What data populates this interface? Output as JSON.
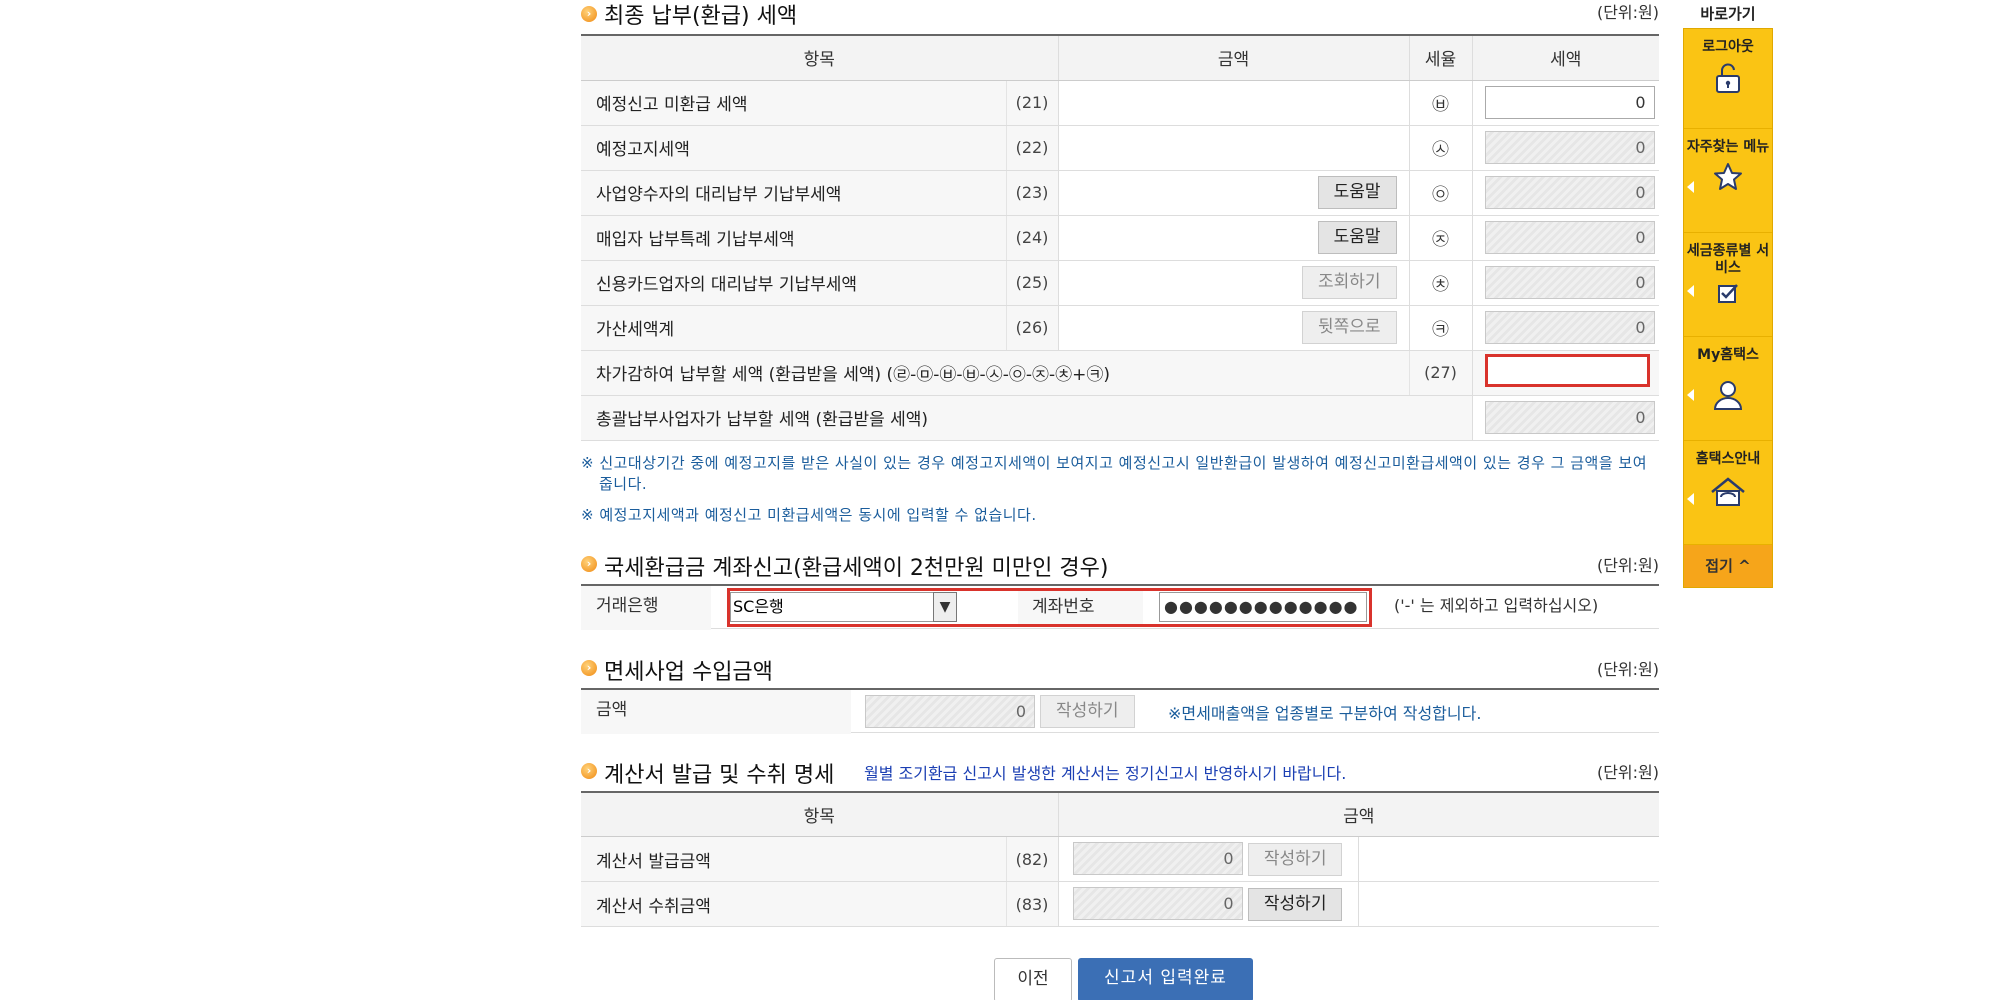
{
  "final": {
    "title": "최종 납부(환급) 세액",
    "unit": "(단위:원)",
    "headers": [
      "항목",
      "금액",
      "세율",
      "세액"
    ],
    "rows": [
      {
        "label": "예정신고 미환급 세액",
        "code": "(21)",
        "rate": "㉥",
        "tax": "0",
        "tax_editable": true,
        "button": ""
      },
      {
        "label": "예정고지세액",
        "code": "(22)",
        "rate": "㉦",
        "tax": "0",
        "tax_editable": false,
        "button": ""
      },
      {
        "label": "사업양수자의 대리납부 기납부세액",
        "code": "(23)",
        "rate": "㉧",
        "tax": "0",
        "tax_editable": false,
        "button": "도움말"
      },
      {
        "label": "매입자 납부특례 기납부세액",
        "code": "(24)",
        "rate": "㉨",
        "tax": "0",
        "tax_editable": false,
        "button": "도움말"
      },
      {
        "label": "신용카드업자의 대리납부 기납부세액",
        "code": "(25)",
        "rate": "㉩",
        "tax": "0",
        "tax_editable": false,
        "button": "조회하기"
      },
      {
        "label": "가산세액계",
        "code": "(26)",
        "rate": "㉪",
        "tax": "0",
        "tax_editable": false,
        "button": "뒷쪽으로"
      }
    ],
    "row27": {
      "label": "차가감하여 납부할 세액 (환급받을 세액) (㉣-㉤-㉥-㉥-㉦-㉧-㉨-㉩+㉪)",
      "code": "(27)",
      "tax": ""
    },
    "row_total": {
      "label": "총괄납부사업자가 납부할 세액 (환급받을 세액)",
      "tax": "0"
    },
    "notes": [
      "※ 신고대상기간 중에 예정고지를 받은 사실이 있는 경우 예정고지세액이 보여지고 예정신고시 일반환급이 발생하여 예정신고미환급세액이 있는 경우 그 금액을 보여줍니다.",
      "※ 예정고지세액과 예정신고 미환급세액은 동시에 입력할 수 없습니다."
    ]
  },
  "refund": {
    "title": "국세환급금 계좌신고(환급세액이 2천만원 미만인 경우)",
    "unit": "(단위:원)",
    "bank_label": "거래은행",
    "bank_value": "SC은행",
    "account_label": "계좌번호",
    "account_value": "●●●●●●●●●●●●●",
    "hint": "('-' 는 제외하고 입력하십시오)"
  },
  "taxfree": {
    "title": "면세사업 수입금액",
    "unit": "(단위:원)",
    "label": "금액",
    "value": "0",
    "button": "작성하기",
    "note": "※면세매출액을 업종별로 구분하여 작성합니다."
  },
  "invoice": {
    "title": "계산서 발급 및 수취 명세",
    "note": "월별 조기환급 신고시 발생한 계산서는 정기신고시 반영하시기 바랍니다.",
    "unit": "(단위:원)",
    "headers": [
      "항목",
      "금액"
    ],
    "rows": [
      {
        "label": "계산서 발급금액",
        "code": "(82)",
        "value": "0",
        "button": "작성하기"
      },
      {
        "label": "계산서 수취금액",
        "code": "(83)",
        "value": "0",
        "button": "작성하기"
      }
    ]
  },
  "bottom": {
    "prev": "이전",
    "done": "신고서 입력완료"
  },
  "quick": {
    "header": "바로가기",
    "items": [
      {
        "label": "로그아웃",
        "icon": "unlock-icon"
      },
      {
        "label": "자주찾는 메뉴",
        "icon": "star-icon"
      },
      {
        "label": "세금종류별 서비스",
        "icon": "check-icon"
      },
      {
        "label": "My홈택스",
        "icon": "user-icon"
      },
      {
        "label": "홈택스안내",
        "icon": "home-icon"
      }
    ],
    "fold": "접기 ^"
  },
  "colors": {
    "accent_red": "#d9332c",
    "quick_yellow": "#fac414",
    "done_blue": "#3b6fb5",
    "note_blue": "#1b5d9c"
  }
}
